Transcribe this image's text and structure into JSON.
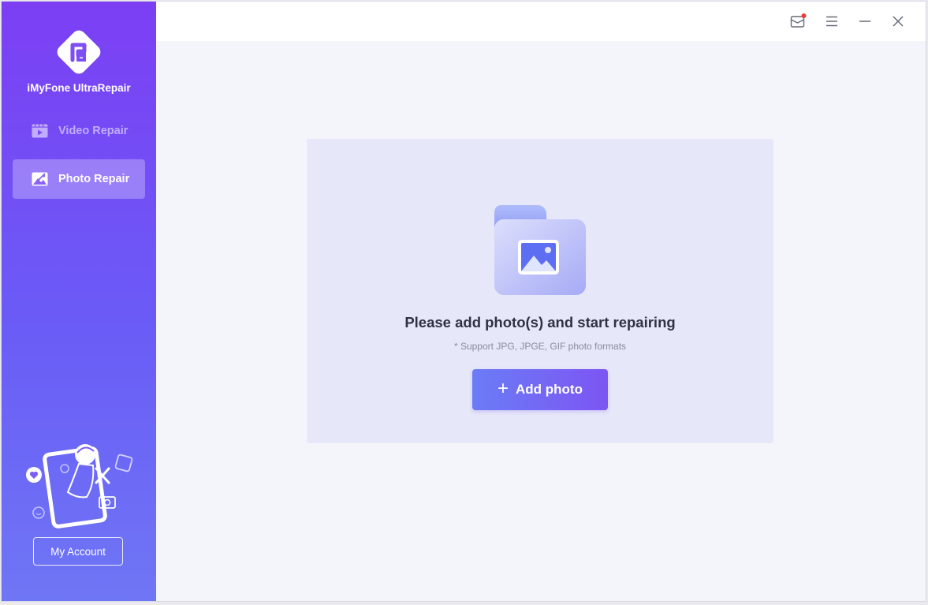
{
  "app": {
    "name": "iMyFone UltraRepair",
    "colors": {
      "sidebar_top": "#7c3ff4",
      "sidebar_bottom": "#6f76f5",
      "accent": "#7d55f3",
      "panel_bg": "#e6e7f9"
    }
  },
  "sidebar": {
    "items": [
      {
        "label": "Video Repair",
        "icon": "video-icon",
        "selected": false
      },
      {
        "label": "Photo Repair",
        "icon": "photo-icon",
        "selected": true
      }
    ],
    "account_label": "My Account"
  },
  "titlebar": {
    "icons": [
      "mail-icon",
      "menu-icon",
      "minimize-icon",
      "close-icon"
    ],
    "mail_has_notification": true
  },
  "main": {
    "title": "Please add photo(s) and start repairing",
    "subtitle": "* Support JPG, JPGE, GIF photo formats",
    "add_button": {
      "icon": "+",
      "label": "Add photo"
    }
  }
}
